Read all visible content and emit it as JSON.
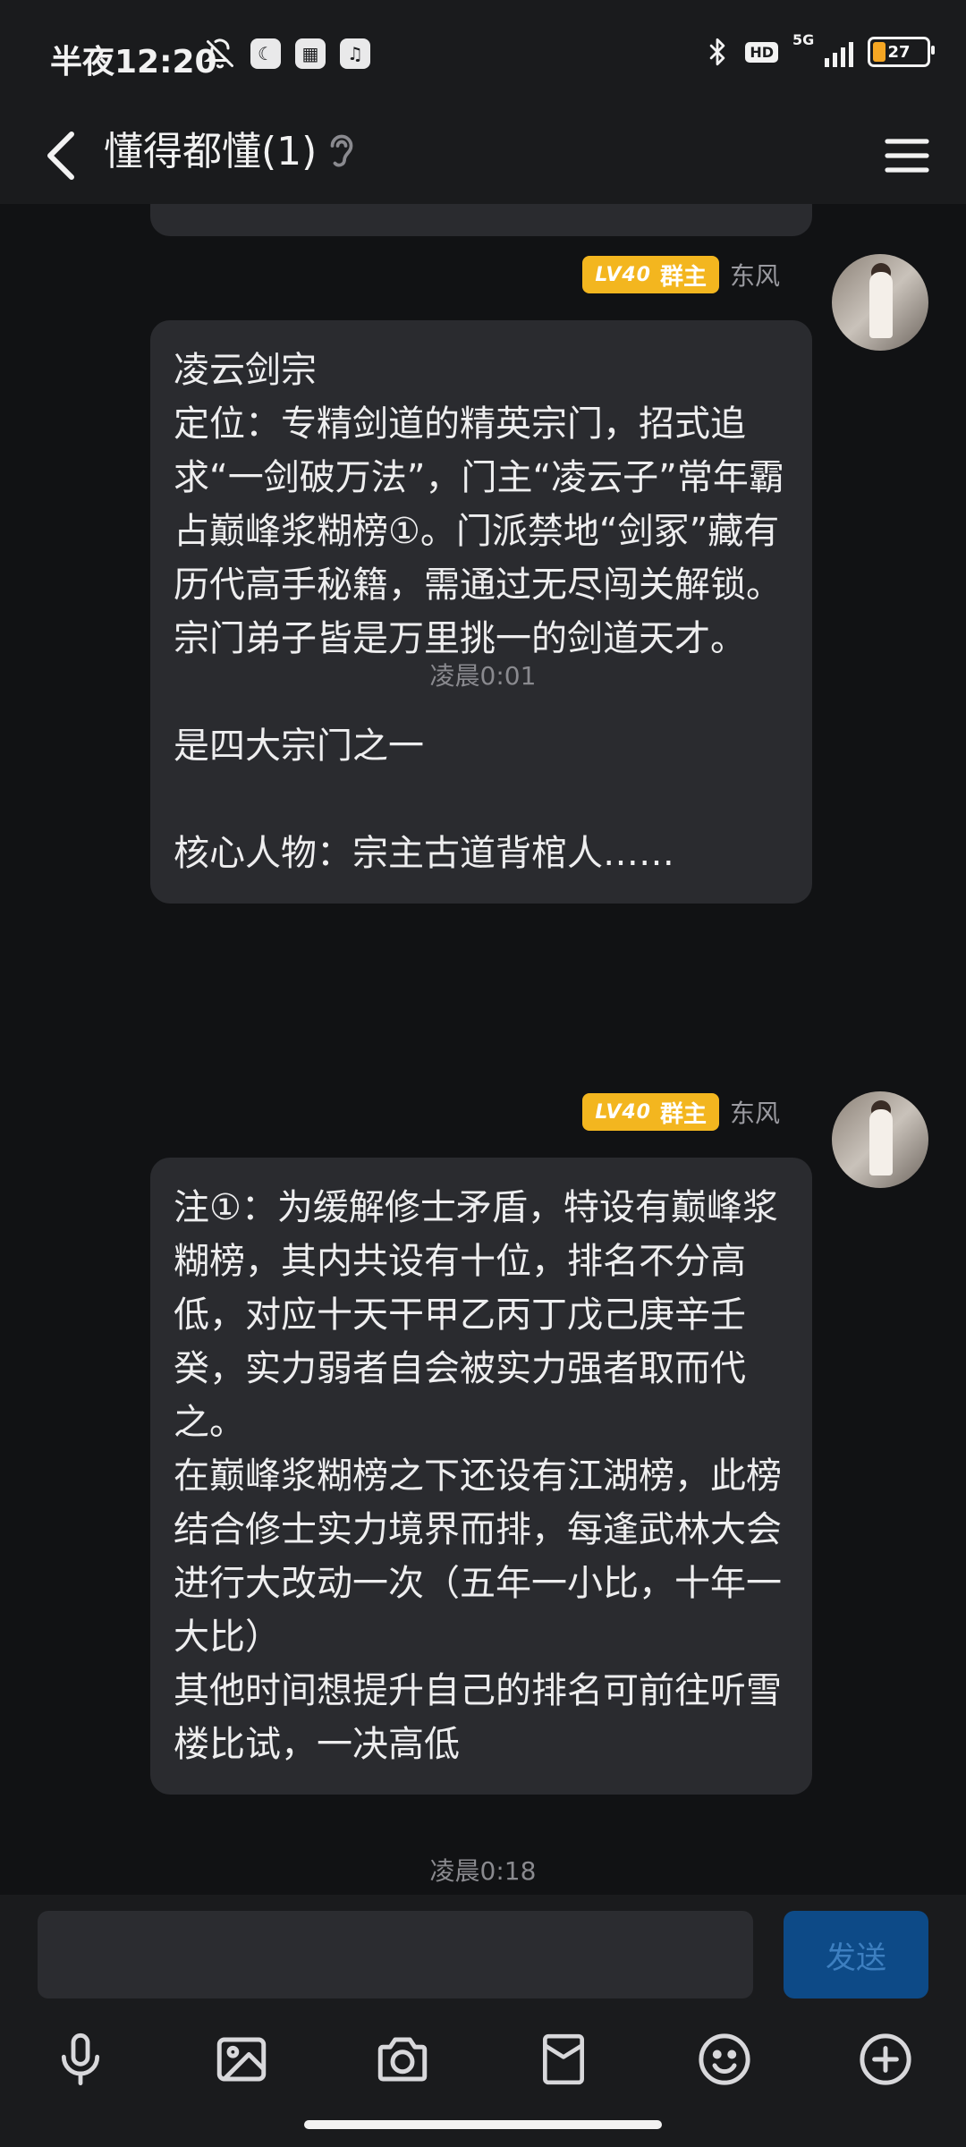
{
  "status_bar": {
    "time": "半夜12:20",
    "network": "5G",
    "hd": "HD",
    "battery": "27",
    "battery_level": 0.27
  },
  "header": {
    "title": "懂得都懂(1)"
  },
  "messages": [
    {
      "badge_level": "LV40",
      "badge_role": "群主",
      "sender": "东风",
      "text": "凌云剑宗\n定位：专精剑道的精英宗门，招式追求“一剑破万法”，门主“凌云子”常年霸占巅峰浆糊榜①。门派禁地“剑冢”藏有历代高手秘籍，需通过无尽闯关解锁。宗门弟子皆是万里挑一的剑道天才。\n\n是四大宗门之一\n\n核心人物：宗主古道背棺人……",
      "time": "凌晨0:01"
    },
    {
      "badge_level": "LV40",
      "badge_role": "群主",
      "sender": "东风",
      "text": "注①：为缓解修士矛盾，特设有巅峰浆糊榜，其内共设有十位，排名不分高低，对应十天干甲乙丙丁戊己庚辛壬癸，实力弱者自会被实力强者取而代之。\n在巅峰浆糊榜之下还设有江湖榜，此榜结合修士实力境界而排，每逢武林大会进行大改动一次（五年一小比，十年一大比）\n其他时间想提升自己的排名可前往听雪楼比试，一决高低",
      "time": "凌晨0:18"
    }
  ],
  "input": {
    "send_label": "发送",
    "value": ""
  },
  "toolbar": {
    "items": [
      "microphone-icon",
      "image-icon",
      "camera-icon",
      "red-envelope-icon",
      "emoji-icon",
      "plus-icon"
    ]
  }
}
